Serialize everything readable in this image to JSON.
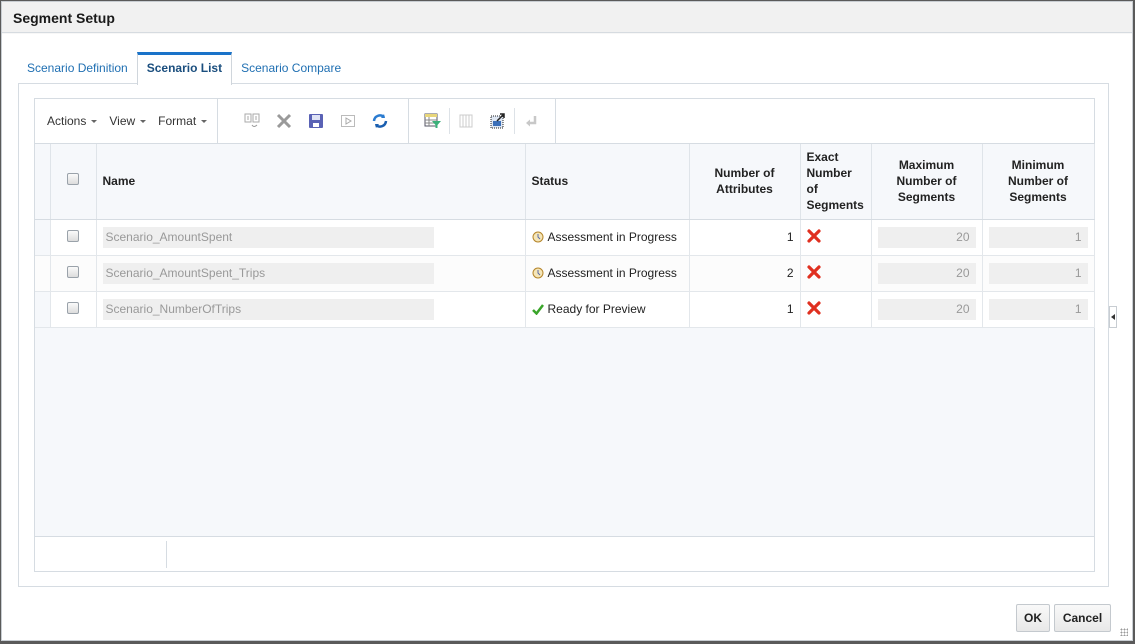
{
  "dialog": {
    "title": "Segment Setup",
    "tabs": [
      {
        "label": "Scenario Definition",
        "active": false
      },
      {
        "label": "Scenario List",
        "active": true
      },
      {
        "label": "Scenario Compare",
        "active": false
      }
    ]
  },
  "toolbar": {
    "menus": [
      "Actions",
      "View",
      "Format"
    ],
    "icons": [
      {
        "name": "copy-icon",
        "enabled": false
      },
      {
        "name": "delete-icon",
        "enabled": false
      },
      {
        "name": "save-icon",
        "enabled": true
      },
      {
        "name": "run-icon",
        "enabled": false
      },
      {
        "name": "refresh-icon",
        "enabled": true
      },
      {
        "name": "query-by-example-icon",
        "enabled": true
      },
      {
        "name": "freeze-icon",
        "enabled": false
      },
      {
        "name": "detach-icon",
        "enabled": true
      },
      {
        "name": "wrap-icon",
        "enabled": false
      }
    ]
  },
  "table": {
    "columns": [
      "Name",
      "Status",
      "Number of Attributes",
      "Exact Number of Segments",
      "Maximum Number of Segments",
      "Minimum Number of Segments"
    ],
    "rows": [
      {
        "name": "Scenario_AmountSpent",
        "status": "Assessment in Progress",
        "status_icon": "in-progress-icon",
        "attributes": "1",
        "exact": "no",
        "max": "20",
        "min": "1"
      },
      {
        "name": "Scenario_AmountSpent_Trips",
        "status": "Assessment in Progress",
        "status_icon": "in-progress-icon",
        "attributes": "2",
        "exact": "no",
        "max": "20",
        "min": "1"
      },
      {
        "name": "Scenario_NumberOfTrips",
        "status": "Ready for Preview",
        "status_icon": "checkmark-icon",
        "attributes": "1",
        "exact": "no",
        "max": "20",
        "min": "1"
      }
    ]
  },
  "buttons": {
    "ok": "OK",
    "cancel": "Cancel"
  },
  "colors": {
    "accent": "#1a73c9",
    "error_x": "#e03020",
    "success_check": "#3aa52a"
  }
}
